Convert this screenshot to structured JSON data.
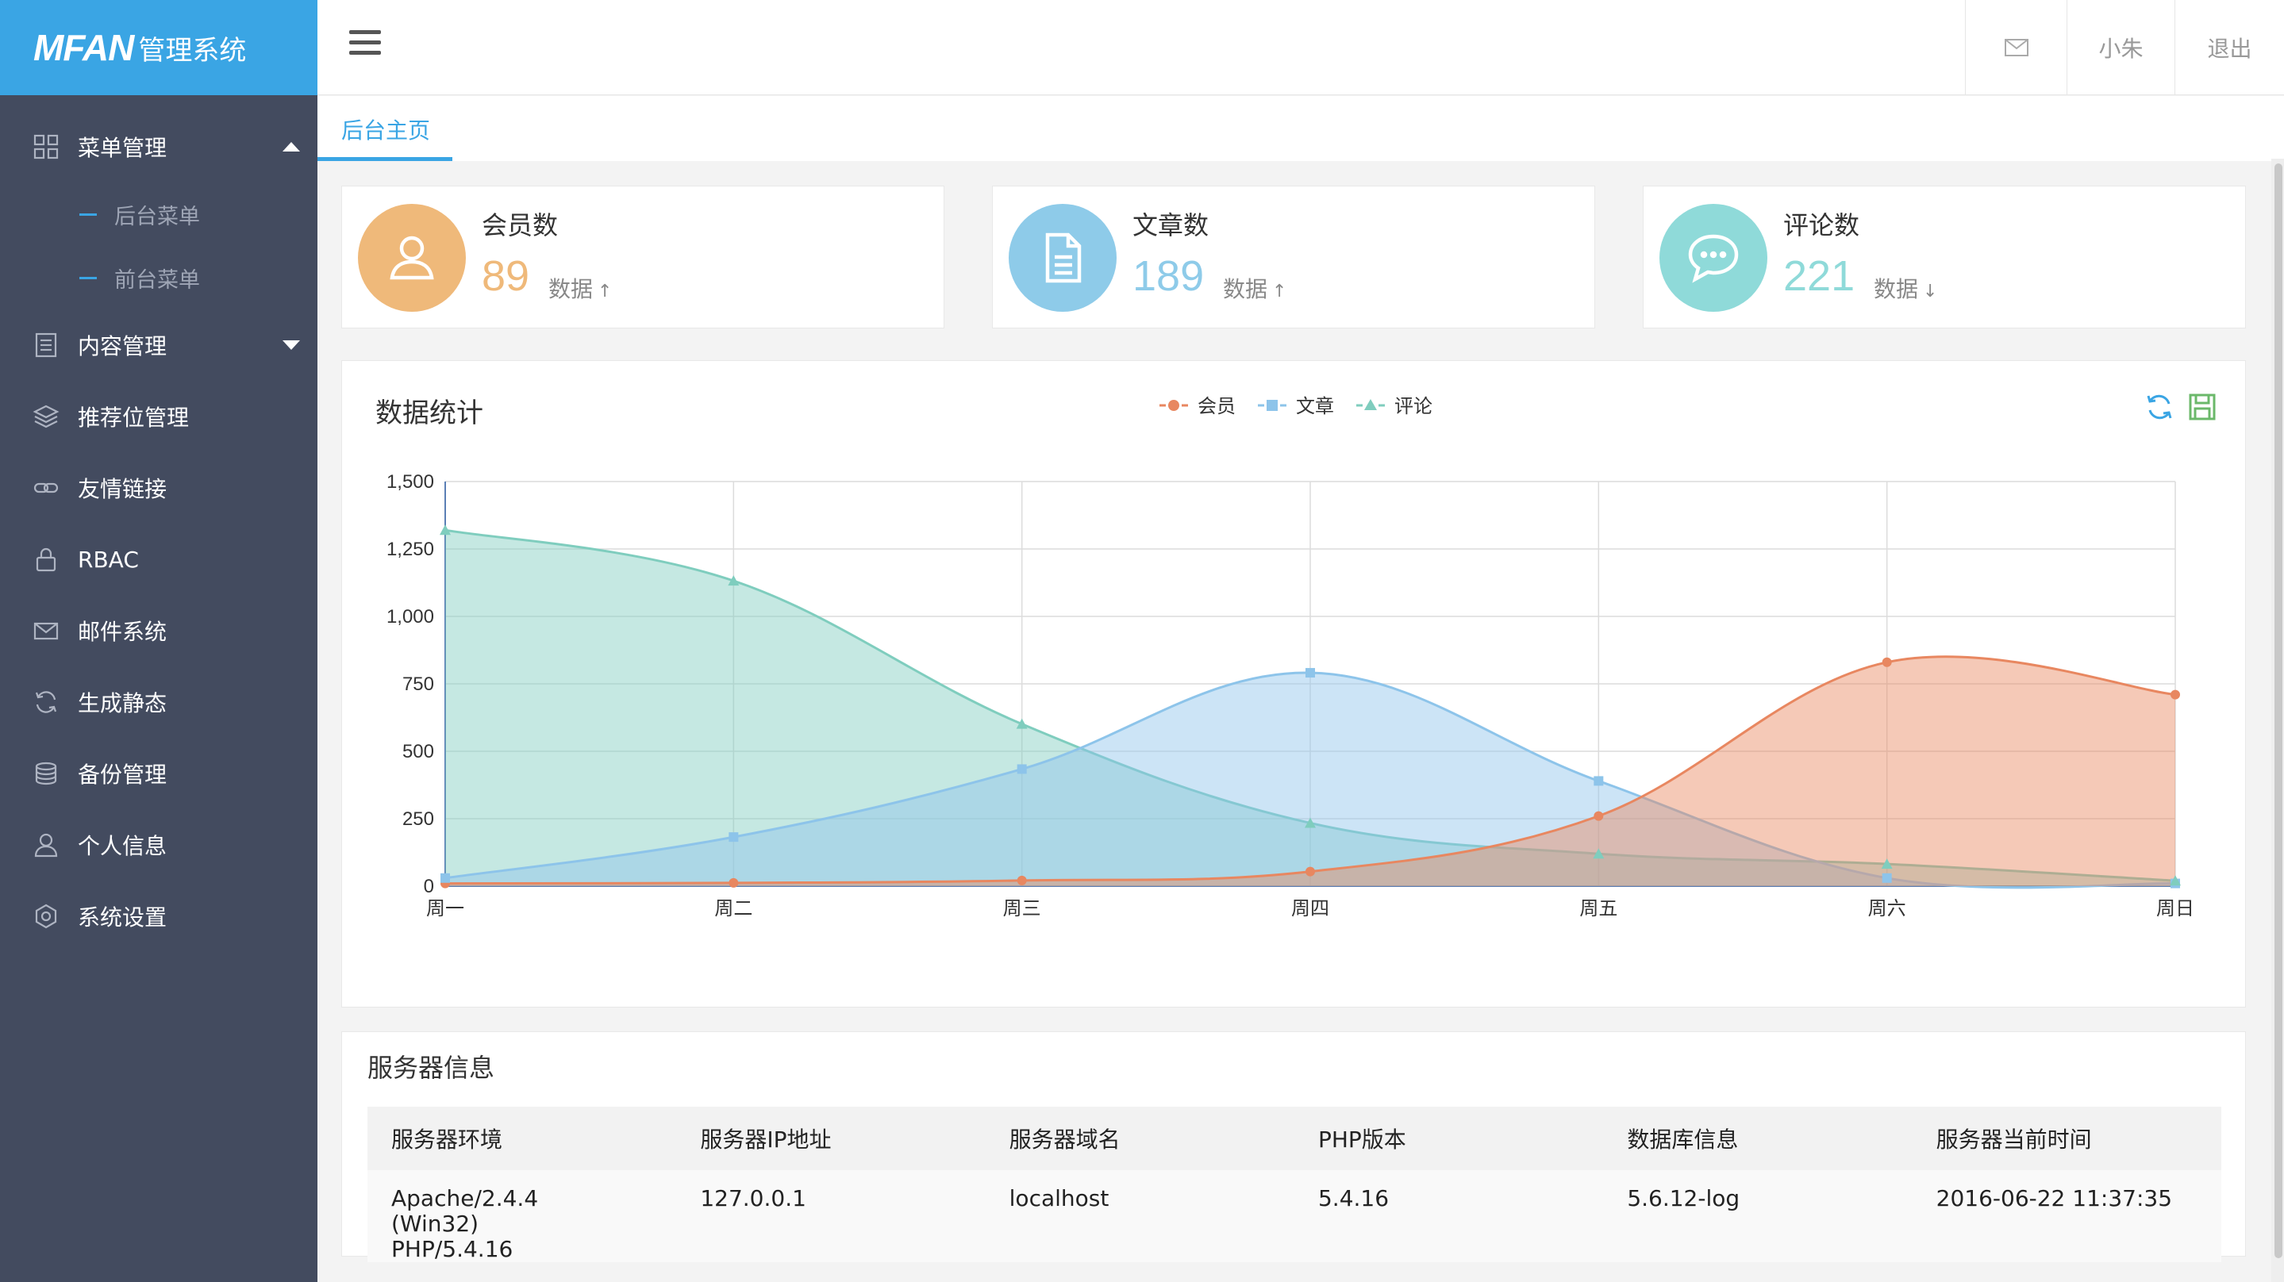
{
  "app": {
    "logo_brand": "MFAN",
    "logo_sub": "管理系统"
  },
  "sidebar": {
    "items": [
      {
        "label": "菜单管理",
        "icon": "grid-icon",
        "expanded": true,
        "children": [
          "后台菜单",
          "前台菜单"
        ]
      },
      {
        "label": "内容管理",
        "icon": "document-icon",
        "expanded": false
      },
      {
        "label": "推荐位管理",
        "icon": "layers-icon"
      },
      {
        "label": "友情链接",
        "icon": "link-icon"
      },
      {
        "label": "RBAC",
        "icon": "lock-icon"
      },
      {
        "label": "邮件系统",
        "icon": "mail-icon"
      },
      {
        "label": "生成静态",
        "icon": "refresh-icon"
      },
      {
        "label": "备份管理",
        "icon": "database-icon"
      },
      {
        "label": "个人信息",
        "icon": "user-icon"
      },
      {
        "label": "系统设置",
        "icon": "settings-icon"
      }
    ]
  },
  "topbar": {
    "user": "小朱",
    "logout": "退出",
    "mail_icon": "mail-icon",
    "menu_icon": "hamburger-icon"
  },
  "tabs": [
    {
      "label": "后台主页",
      "active": true
    }
  ],
  "stats": [
    {
      "title": "会员数",
      "value": "89",
      "meta": "数据",
      "trend": "up",
      "color": "#efb97a",
      "icon": "user-icon"
    },
    {
      "title": "文章数",
      "value": "189",
      "meta": "数据",
      "trend": "up",
      "color": "#8ecbe9",
      "icon": "document-icon"
    },
    {
      "title": "评论数",
      "value": "221",
      "meta": "数据",
      "trend": "down",
      "color": "#8fdad9",
      "icon": "chat-bubble-icon"
    }
  ],
  "chart_panel": {
    "title": "数据统计",
    "tools": [
      "refresh-icon",
      "save-icon"
    ]
  },
  "chart_data": {
    "type": "area",
    "title": "数据统计",
    "categories": [
      "周一",
      "周二",
      "周三",
      "周四",
      "周五",
      "周六",
      "周日"
    ],
    "series": [
      {
        "name": "会员",
        "color": "#e88760",
        "marker": "circle",
        "values": [
          10,
          12,
          21,
          54,
          260,
          830,
          710
        ]
      },
      {
        "name": "文章",
        "color": "#8dc4ea",
        "marker": "square",
        "values": [
          30,
          182,
          434,
          791,
          390,
          30,
          10
        ]
      },
      {
        "name": "评论",
        "color": "#7fcdbe",
        "marker": "triangle",
        "values": [
          1320,
          1132,
          601,
          234,
          120,
          82,
          20
        ]
      }
    ],
    "ylim": [
      0,
      1500
    ],
    "yticks": [
      "0",
      "250",
      "500",
      "750",
      "1,000",
      "1,250",
      "1,500"
    ],
    "grid": true,
    "legend": "top-center",
    "smooth": true
  },
  "server": {
    "title": "服务器信息",
    "columns": [
      "服务器环境",
      "服务器IP地址",
      "服务器域名",
      "PHP版本",
      "数据库信息",
      "服务器当前时间"
    ],
    "row": [
      "Apache/2.4.4 (Win32) PHP/5.4.16",
      "127.0.0.1",
      "localhost",
      "5.4.16",
      "5.6.12-log",
      "2016-06-22 11:37:35"
    ]
  }
}
